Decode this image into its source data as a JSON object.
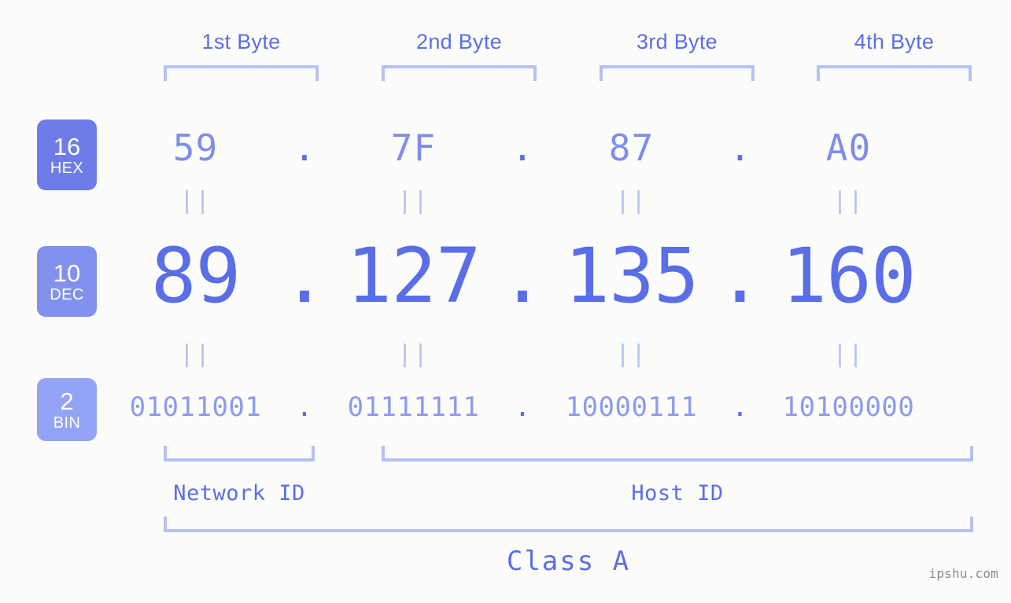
{
  "background_color": "#fcfdfa",
  "byte_headers": [
    {
      "label": "1st Byte"
    },
    {
      "label": "2nd Byte"
    },
    {
      "label": "3rd Byte"
    },
    {
      "label": "4th Byte"
    }
  ],
  "bases": [
    {
      "number": "16",
      "name": "HEX",
      "color": "#6d7ce8"
    },
    {
      "number": "10",
      "name": "DEC",
      "color": "#8391ee"
    },
    {
      "number": "2",
      "name": "BIN",
      "color": "#93a3f5"
    }
  ],
  "rows": {
    "hex": {
      "base_number": "16",
      "base_name": "HEX",
      "values": [
        "59",
        "7F",
        "87",
        "A0"
      ],
      "separator": ".",
      "color": "#7f8eeb"
    },
    "dec": {
      "base_number": "10",
      "base_name": "DEC",
      "values": [
        "89",
        "127",
        "135",
        "160"
      ],
      "separator": ".",
      "color": "#5a6ee8"
    },
    "bin": {
      "base_number": "2",
      "base_name": "BIN",
      "values": [
        "01011001",
        "01111111",
        "10000111",
        "10100000"
      ],
      "separator": ".",
      "color": "#8b9bf0"
    }
  },
  "equals_marker": "||",
  "sections": [
    {
      "label": "Network ID"
    },
    {
      "label": "Host ID"
    }
  ],
  "class": {
    "label": "Class A"
  },
  "watermark": {
    "text": "ipshu.com"
  },
  "bracket_color": "#b6c0f8"
}
